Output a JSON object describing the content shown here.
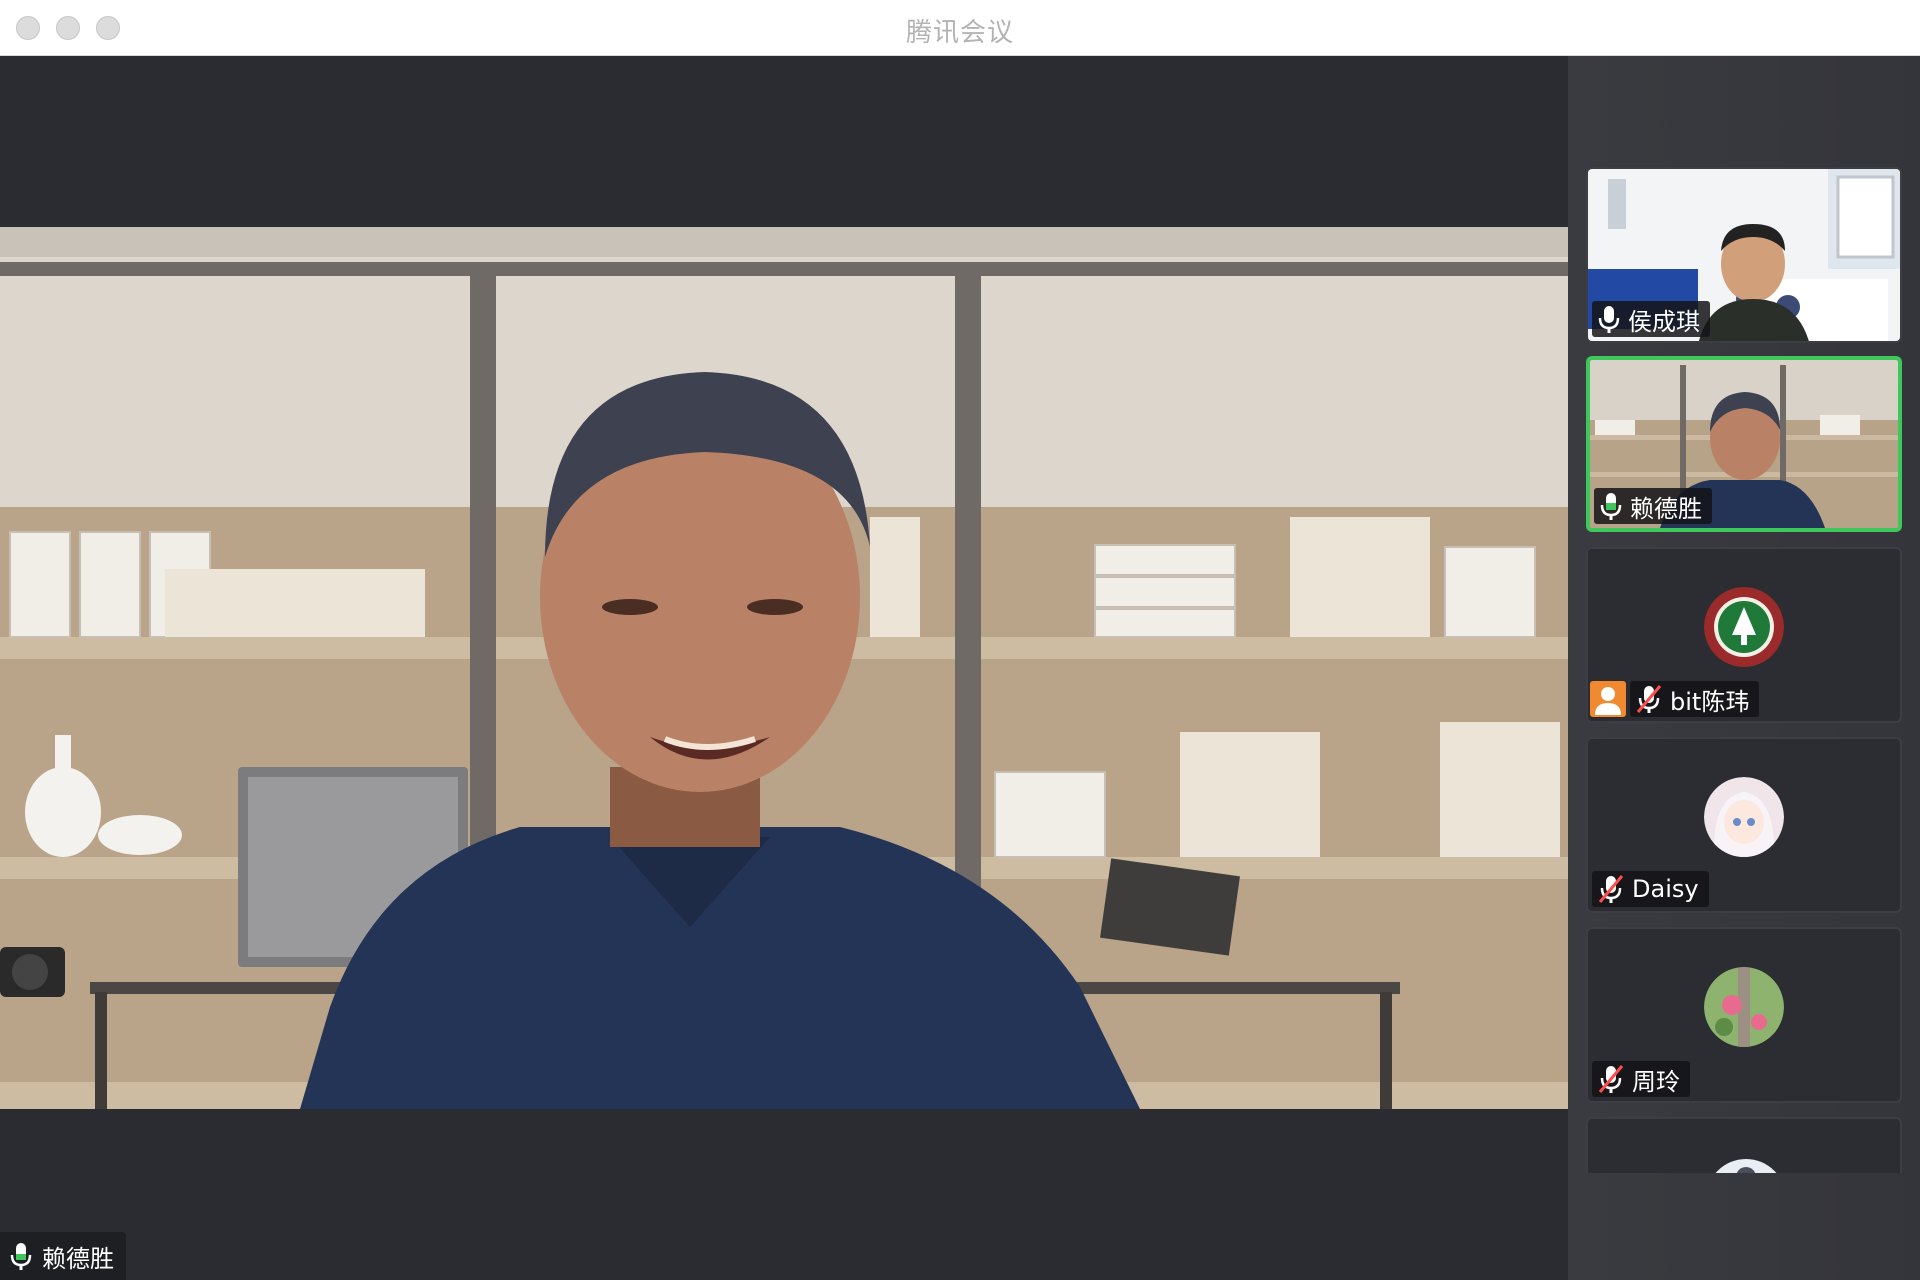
{
  "window": {
    "title": "腾讯会议"
  },
  "main_video": {
    "speaker_name": "赖德胜",
    "mic_state": "active"
  },
  "participants": [
    {
      "name": "侯成琪",
      "mic": "on",
      "video": "on",
      "active": false
    },
    {
      "name": "赖德胜",
      "mic": "on",
      "video": "on",
      "active": true
    },
    {
      "name": "bit陈玮",
      "mic": "muted",
      "video": "off",
      "avatar": "university-logo",
      "badge": "host-icon"
    },
    {
      "name": "Daisy",
      "mic": "muted",
      "video": "off",
      "avatar": "anime-avatar"
    },
    {
      "name": "周玲",
      "mic": "muted",
      "video": "off",
      "avatar": "flower-avatar"
    },
    {
      "name": "",
      "mic": "",
      "video": "off",
      "avatar": "partial-avatar"
    }
  ],
  "colors": {
    "active_border": "#3ec75a",
    "badge": "#f0892f",
    "background": "#2b2c31"
  }
}
